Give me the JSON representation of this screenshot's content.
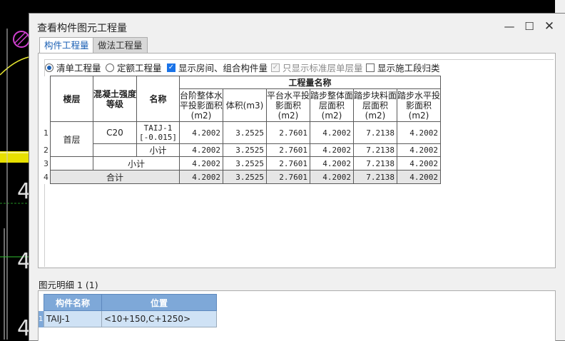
{
  "dialog": {
    "title": "查看构件图元工程量",
    "tabs": [
      "构件工程量",
      "做法工程量"
    ]
  },
  "options": {
    "radio_list": "清单工程量",
    "radio_quota": "定额工程量",
    "check_room": "显示房间、组合构件量",
    "check_std": "只显示标准层单层量",
    "check_section": "显示施工段归类"
  },
  "table": {
    "group_header": "工程量名称",
    "col_floor": "楼层",
    "col_grade": "混凝土强度等级",
    "col_name": "名称",
    "qty_headers": [
      "台阶整体水平投影面积(m2)",
      "体积(m3)",
      "平台水平投影面积(m2)",
      "踏步整体面层面积(m2)",
      "踏步块料面层面积(m2)",
      "踏步水平投影面积(m2)"
    ],
    "row_numbers": [
      "1",
      "2",
      "3",
      "4"
    ],
    "floor": "首层",
    "grade": "C20",
    "name": "TAIJ-1 [-0.015]",
    "subtotal_label": "小计",
    "total_label": "合计",
    "row1": [
      "4.2002",
      "3.2525",
      "2.7601",
      "4.2002",
      "7.2138",
      "4.2002"
    ],
    "row2": [
      "4.2002",
      "3.2525",
      "2.7601",
      "4.2002",
      "7.2138",
      "4.2002"
    ],
    "row3": [
      "4.2002",
      "3.2525",
      "2.7601",
      "4.2002",
      "7.2138",
      "4.2002"
    ],
    "row4": [
      "4.2002",
      "3.2525",
      "2.7601",
      "4.2002",
      "7.2138",
      "4.2002"
    ]
  },
  "detail": {
    "label": "图元明细 1 (1)",
    "col_name": "构件名称",
    "col_pos": "位置",
    "row_number": "1",
    "name": "TAIJ-1",
    "pos": "<10+150,C+1250>"
  },
  "cad": {
    "labels": [
      "4",
      "4",
      "4"
    ]
  }
}
